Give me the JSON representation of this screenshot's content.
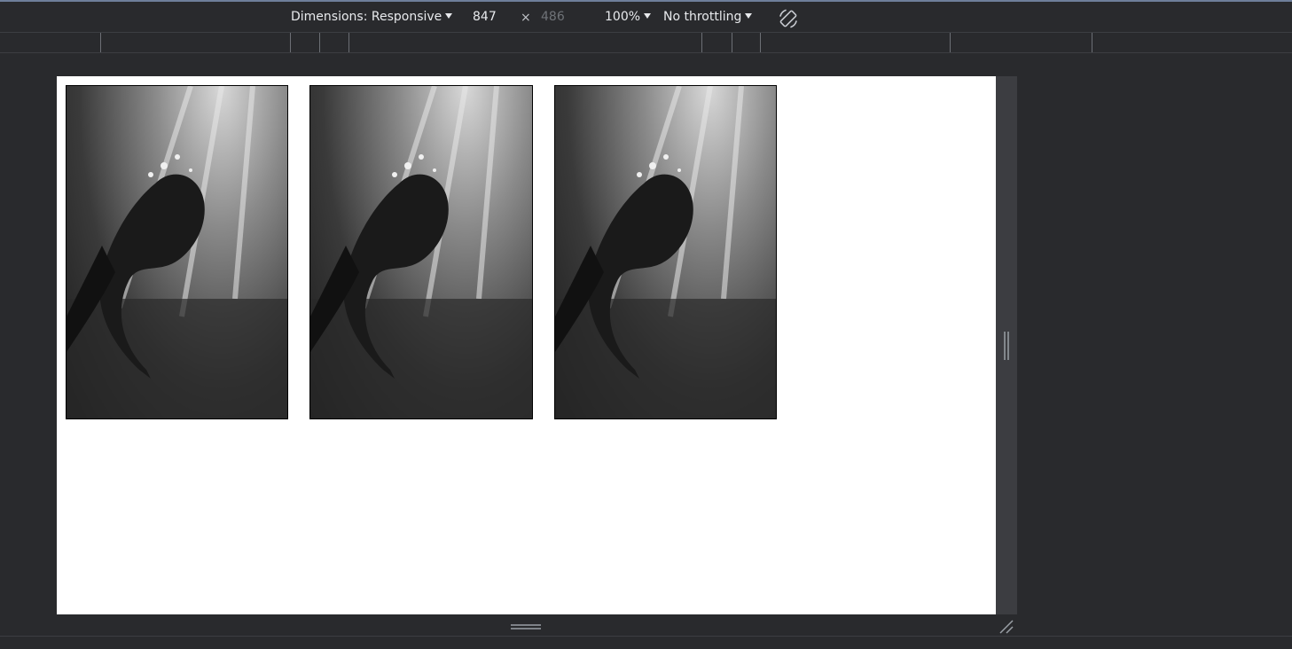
{
  "toolbar": {
    "dimensions_label": "Dimensions: Responsive",
    "width_value": "847",
    "times_symbol": "×",
    "height_placeholder": "486",
    "zoom_label": "100%",
    "throttling_label": "No throttling",
    "rotate_icon": "rotate-icon"
  },
  "viewport": {
    "images": [
      {
        "alt": "underwater-figure-photo-1"
      },
      {
        "alt": "underwater-figure-photo-2"
      },
      {
        "alt": "underwater-figure-photo-3"
      }
    ]
  },
  "colors": {
    "devtools_bg": "#292a2d",
    "viewport_bg": "#ffffff",
    "text": "#e8eaed",
    "muted_text": "#6f7378",
    "toolbar_accent": "#6e7f9a"
  }
}
